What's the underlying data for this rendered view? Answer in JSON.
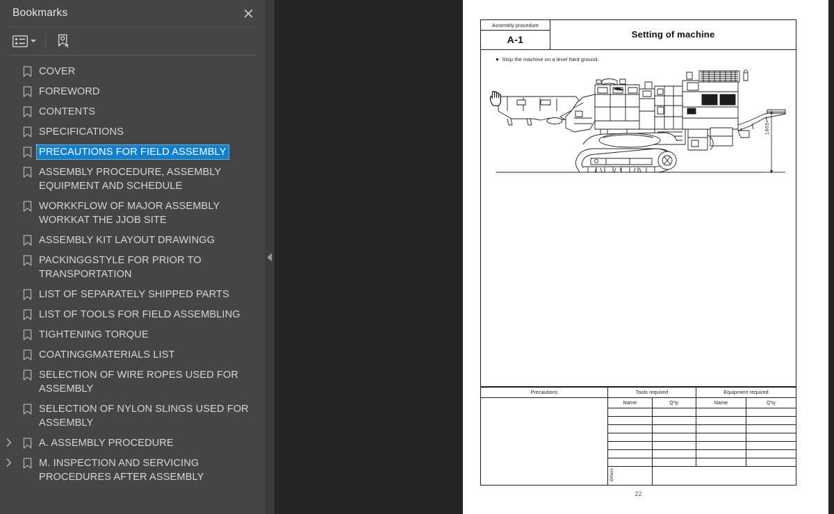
{
  "panel": {
    "title": "Bookmarks",
    "close_icon": "close-icon",
    "toolbar": {
      "list_options_icon": "list-options-icon",
      "list_options_caret": "chevron-down-icon",
      "add_bookmark_icon": "add-bookmark-icon"
    },
    "collapse_icon": "collapse-left-arrow-icon",
    "accent_selected": "#0f7fd4",
    "panel_bg": "#454545",
    "viewer_bg": "#262626",
    "items": [
      {
        "label": "COVER",
        "expandable": false,
        "selected": false
      },
      {
        "label": "FOREWORD",
        "expandable": false,
        "selected": false
      },
      {
        "label": "CONTENTS",
        "expandable": false,
        "selected": false
      },
      {
        "label": "SPECIFICATIONS",
        "expandable": false,
        "selected": false
      },
      {
        "label": "PRECAUTIONS FOR FIELD ASSEMBLY",
        "expandable": false,
        "selected": true
      },
      {
        "label": "ASSEMBLY PROCEDURE, ASSEMBLY EQUIPMENT AND SCHEDULE",
        "expandable": false,
        "selected": false
      },
      {
        "label": "WORKKFLOW OF MAJOR ASSEMBLY WORKKAT THE JJOB SITE",
        "expandable": false,
        "selected": false
      },
      {
        "label": "ASSEMBLY KIT LAYOUT DRAWINGG",
        "expandable": false,
        "selected": false
      },
      {
        "label": "PACKINGGSTYLE FOR PRIOR TO TRANSPORTATION",
        "expandable": false,
        "selected": false
      },
      {
        "label": "LIST OF SEPARATELY SHIPPED PARTS",
        "expandable": false,
        "selected": false
      },
      {
        "label": "LIST OF TOOLS FOR FIELD ASSEMBLING",
        "expandable": false,
        "selected": false
      },
      {
        "label": "TIGHTENING TORQUE",
        "expandable": false,
        "selected": false
      },
      {
        "label": "COATINGGMATERIALS LIST",
        "expandable": false,
        "selected": false
      },
      {
        "label": "SELECTION OF WIRE ROPES USED FOR ASSEMBLY",
        "expandable": false,
        "selected": false
      },
      {
        "label": "SELECTION OF NYLON SLINGS USED FOR ASSEMBLY",
        "expandable": false,
        "selected": false
      },
      {
        "label": "A. ASSEMBLY PROCEDURE",
        "expandable": true,
        "selected": false
      },
      {
        "label": "M. INSPECTION AND SERVICING PROCEDURES AFTER ASSEMBLY",
        "expandable": true,
        "selected": false
      }
    ]
  },
  "document": {
    "title_block": {
      "category_label": "Assembly procedure",
      "procedure_code": "A-1",
      "sheet_title": "Setting of machine"
    },
    "instruction": "Stop the machine on a level hard ground.",
    "drawing": {
      "name": "crawler-mobile-crusher-side-view",
      "dimension_label": "1865"
    },
    "table": {
      "headers": {
        "precautions": "Precautions",
        "tools_required": "Tools required",
        "equipment_required": "Equipment required"
      },
      "sub_headers": {
        "name": "Name",
        "qty": "Q'ty"
      },
      "others_label": "Others",
      "empty_rows": 7
    },
    "page_number": "22"
  },
  "cursor": {
    "icon": "pointing-hand-cursor"
  }
}
